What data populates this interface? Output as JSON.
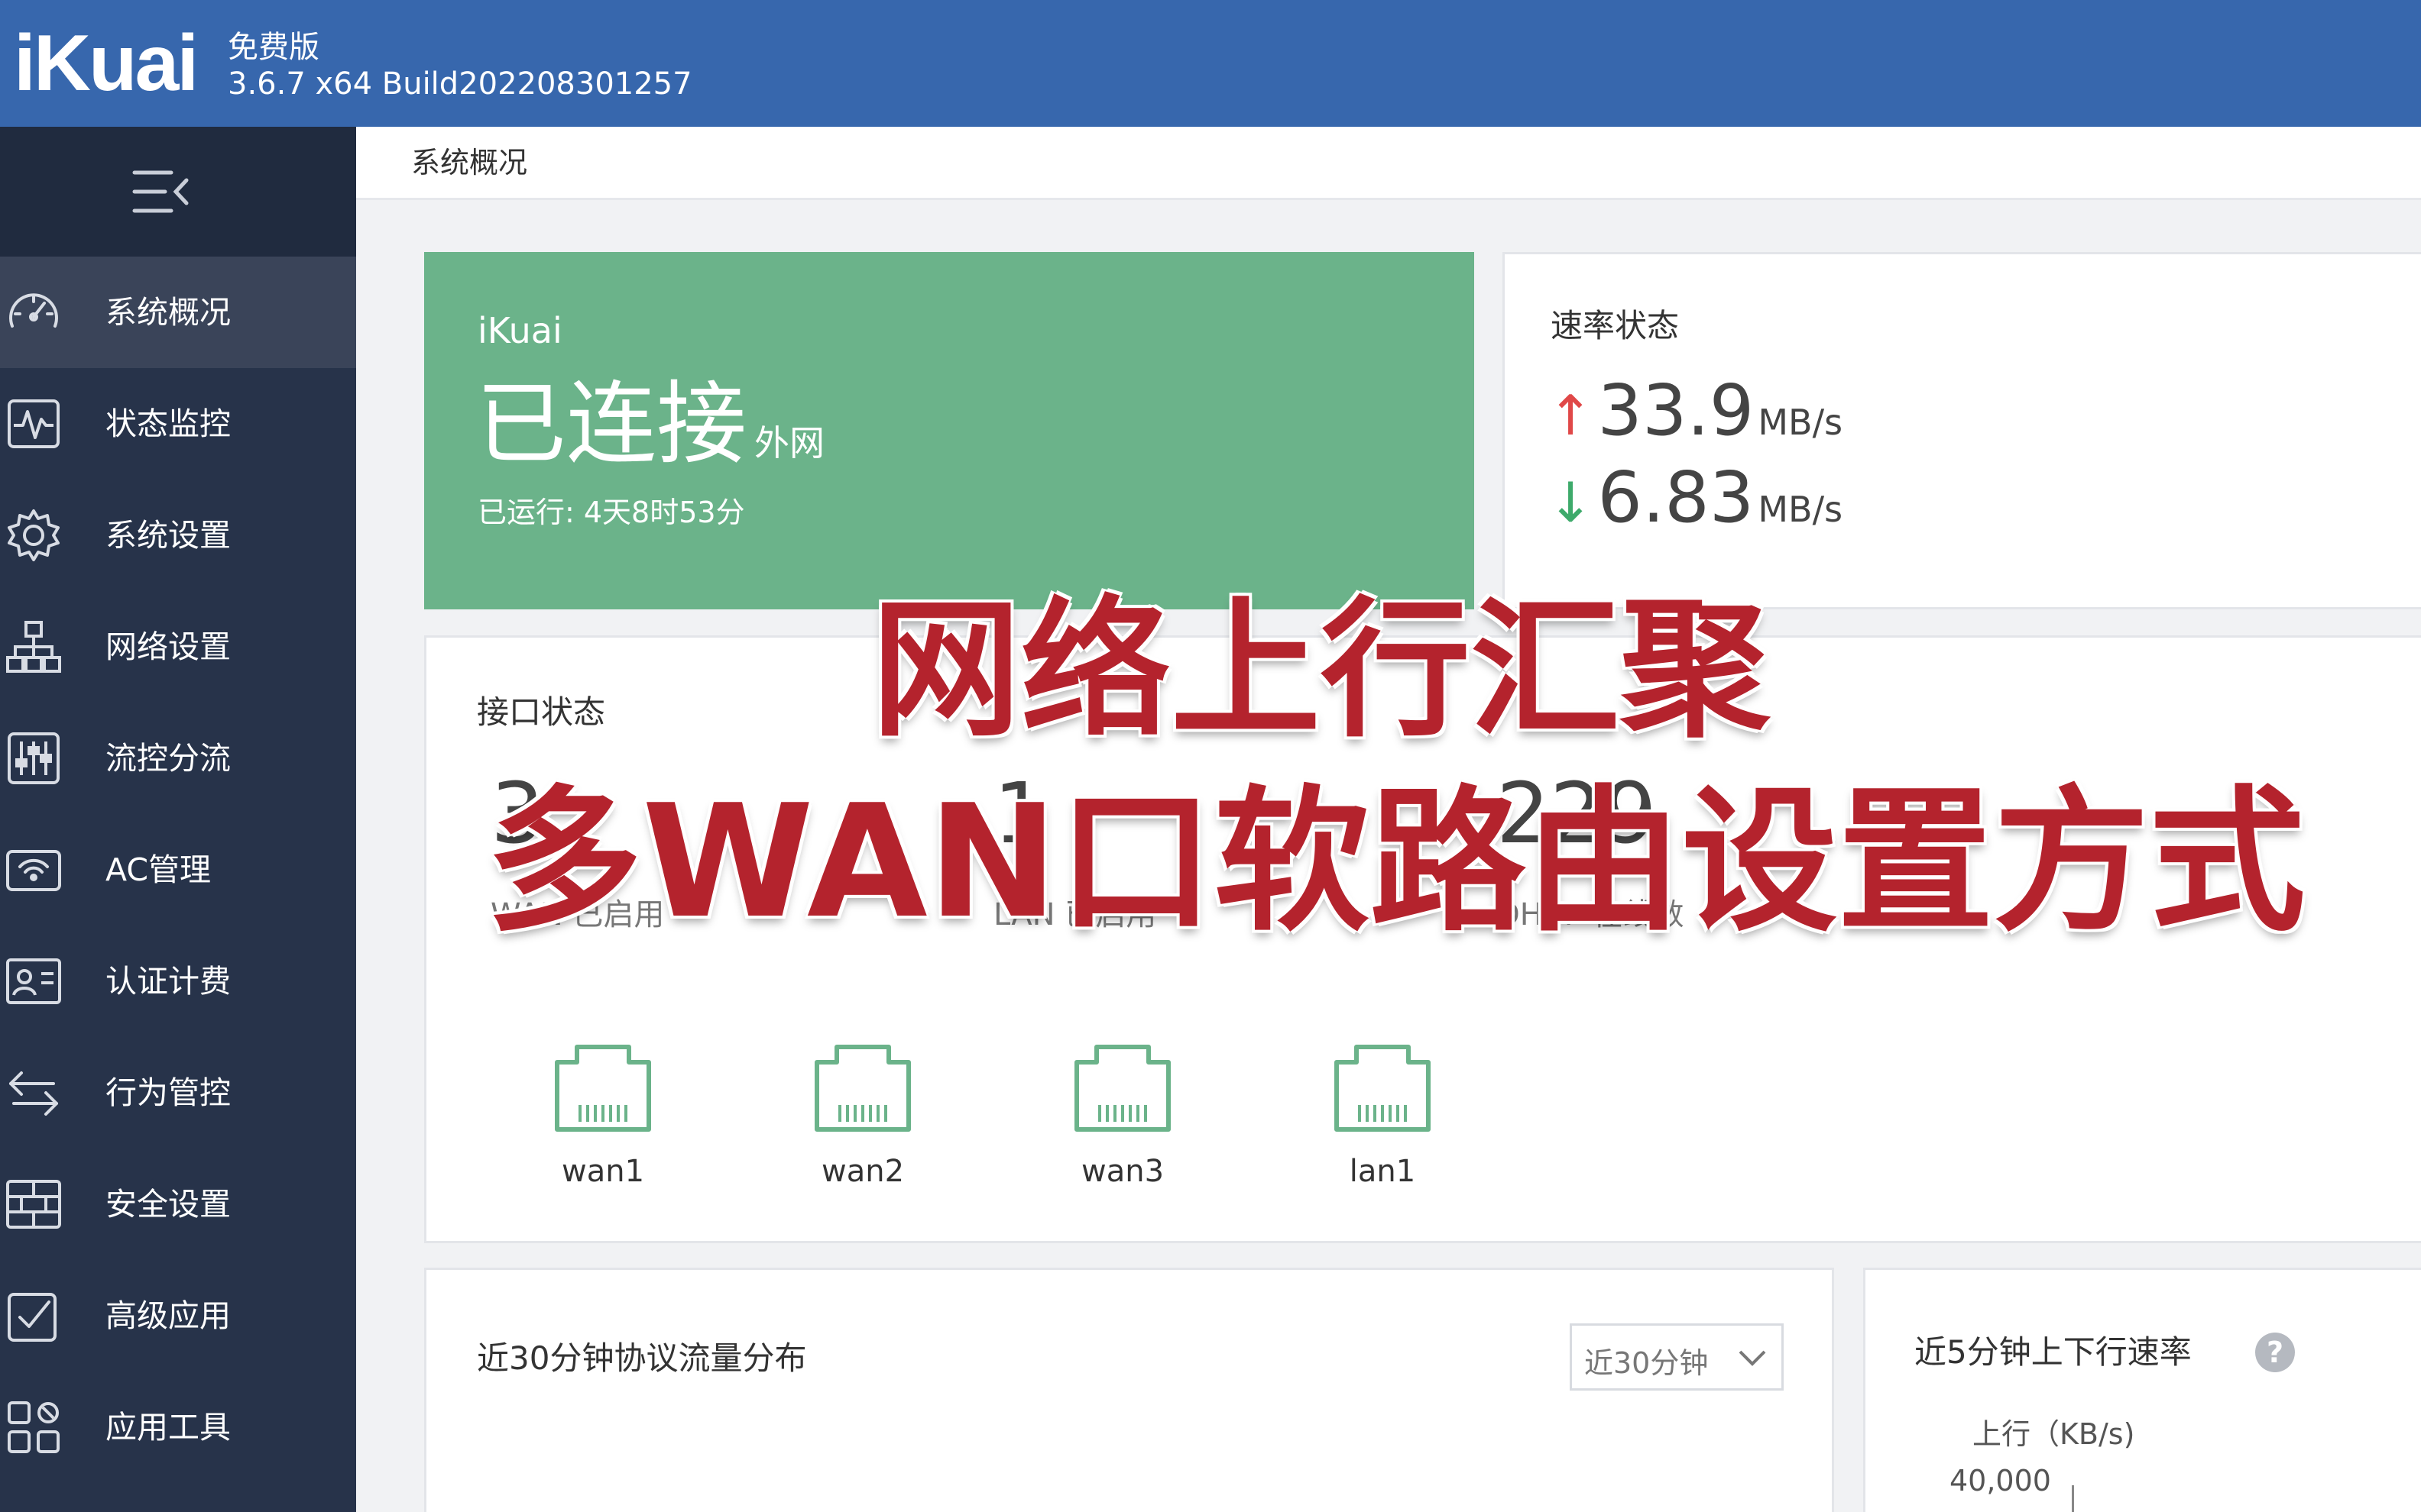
{
  "header": {
    "logo": "iKuai",
    "edition": "免费版",
    "version": "3.6.7 x64 Build202208301257"
  },
  "sidebar": {
    "items": [
      {
        "label": "系统概况",
        "icon": "dashboard-icon",
        "active": true
      },
      {
        "label": "状态监控",
        "icon": "pulse-monitor-icon",
        "active": false
      },
      {
        "label": "系统设置",
        "icon": "gear-icon",
        "active": false
      },
      {
        "label": "网络设置",
        "icon": "network-tree-icon",
        "active": false
      },
      {
        "label": "流控分流",
        "icon": "sliders-icon",
        "active": false
      },
      {
        "label": "AC管理",
        "icon": "wifi-ap-icon",
        "active": false
      },
      {
        "label": "认证计费",
        "icon": "id-card-icon",
        "active": false
      },
      {
        "label": "行为管控",
        "icon": "swap-arrows-icon",
        "active": false
      },
      {
        "label": "安全设置",
        "icon": "firewall-brick-icon",
        "active": false
      },
      {
        "label": "高级应用",
        "icon": "checked-box-icon",
        "active": false
      },
      {
        "label": "应用工具",
        "icon": "apps-grid-icon",
        "active": false
      }
    ]
  },
  "breadcrumb": "系统概况",
  "connection": {
    "brand": "iKuai",
    "status": "已连接",
    "status_sub": "外网",
    "uptime": "已运行: 4天8时53分"
  },
  "rate": {
    "title": "速率状态",
    "up_arrow": "↑",
    "up_value": "33.9",
    "up_unit": "MB/s",
    "down_arrow": "↓",
    "down_value": "6.83",
    "down_unit": "MB/s"
  },
  "interfaces": {
    "title": "接口状态",
    "stats": [
      {
        "value": "3",
        "label": "WAN 已启用"
      },
      {
        "value": "1",
        "label": "LAN 已启用"
      },
      {
        "value": "229",
        "label": "DHCP 在线数"
      }
    ],
    "ports": [
      "wan1",
      "wan2",
      "wan3",
      "lan1"
    ]
  },
  "protocol_panel": {
    "title": "近30分钟协议流量分布",
    "range_select": "近30分钟"
  },
  "speed_panel": {
    "title": "近5分钟上下行速率",
    "help": "?",
    "axis_label": "上行（KB/s)",
    "axis_tick": "40,000"
  },
  "overlay": {
    "line1": "网络上行汇聚",
    "line2": "多WAN口软路由设置方式"
  },
  "colors": {
    "header_bg": "#3767ad",
    "sidebar_bg": "#27334a",
    "connected_green": "#6bb38a",
    "overlay_red": "#b4232d",
    "up_red": "#e04848",
    "down_green": "#3eaa6b"
  }
}
